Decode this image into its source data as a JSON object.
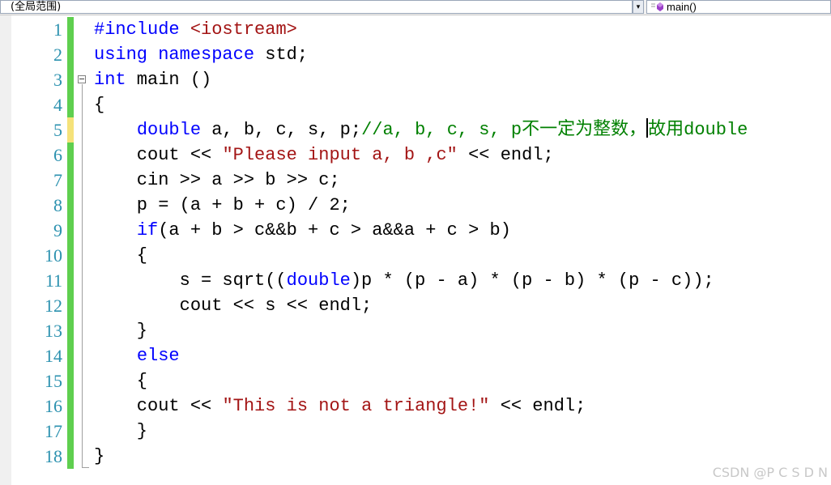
{
  "navbar": {
    "scope_label": "(全局范围)",
    "scope_arrow": "▾",
    "member_label": "main()",
    "member_icon": "method-icon"
  },
  "editor": {
    "line_numbers": [
      "1",
      "2",
      "3",
      "4",
      "5",
      "6",
      "7",
      "8",
      "9",
      "10",
      "11",
      "12",
      "13",
      "14",
      "15",
      "16",
      "17",
      "18"
    ],
    "lines": [
      [
        {
          "t": "#include ",
          "c": "pp"
        },
        {
          "t": "<iostream>",
          "c": "hdr"
        }
      ],
      [
        {
          "t": "using",
          "c": "kw"
        },
        {
          "t": " ",
          "c": ""
        },
        {
          "t": "namespace",
          "c": "kw"
        },
        {
          "t": " std;",
          "c": ""
        }
      ],
      [
        {
          "t": "int",
          "c": "kw"
        },
        {
          "t": " main ()",
          "c": ""
        }
      ],
      [
        {
          "t": "{",
          "c": ""
        }
      ],
      [
        {
          "t": "    ",
          "c": ""
        },
        {
          "t": "double",
          "c": "kw"
        },
        {
          "t": " a, b, c, s, p;",
          "c": ""
        },
        {
          "t": "//a, b, c, s, p不一定为整数，",
          "c": "cmt"
        },
        {
          "t": "|caret|",
          "c": "caret"
        },
        {
          "t": "故用double",
          "c": "cmt"
        }
      ],
      [
        {
          "t": "    cout << ",
          "c": ""
        },
        {
          "t": "\"Please input a, b ,c\"",
          "c": "str"
        },
        {
          "t": " << endl;",
          "c": ""
        }
      ],
      [
        {
          "t": "    cin >> a >> b >> c;",
          "c": ""
        }
      ],
      [
        {
          "t": "    p = (a + b + c) / 2;",
          "c": ""
        }
      ],
      [
        {
          "t": "    ",
          "c": ""
        },
        {
          "t": "if",
          "c": "kw"
        },
        {
          "t": "(a + b > c&&b + c > a&&a + c > b)",
          "c": ""
        }
      ],
      [
        {
          "t": "    {",
          "c": ""
        }
      ],
      [
        {
          "t": "        s = sqrt((",
          "c": ""
        },
        {
          "t": "double",
          "c": "kw"
        },
        {
          "t": ")p * (p - a) * (p - b) * (p - c));",
          "c": ""
        }
      ],
      [
        {
          "t": "        cout << s << endl;",
          "c": ""
        }
      ],
      [
        {
          "t": "    }",
          "c": ""
        }
      ],
      [
        {
          "t": "    ",
          "c": ""
        },
        {
          "t": "else",
          "c": "kw"
        }
      ],
      [
        {
          "t": "    {",
          "c": ""
        }
      ],
      [
        {
          "t": "    cout << ",
          "c": ""
        },
        {
          "t": "\"This is not a triangle!\"",
          "c": "str"
        },
        {
          "t": " << endl;",
          "c": ""
        }
      ],
      [
        {
          "t": "    }",
          "c": ""
        }
      ],
      [
        {
          "t": "}",
          "c": ""
        }
      ]
    ],
    "change_markers": [
      "saved",
      "saved",
      "saved",
      "saved",
      "unsaved",
      "saved",
      "saved",
      "saved",
      "saved",
      "saved",
      "saved",
      "saved",
      "saved",
      "saved",
      "saved",
      "saved",
      "saved",
      "saved"
    ],
    "colors": {
      "keyword": "#0000ff",
      "string": "#a31515",
      "comment": "#008000",
      "line_number": "#2b91af",
      "saved_change": "#5fcf4f",
      "unsaved_change": "#f5e27a"
    }
  },
  "watermark": "CSDN @P C S D N"
}
